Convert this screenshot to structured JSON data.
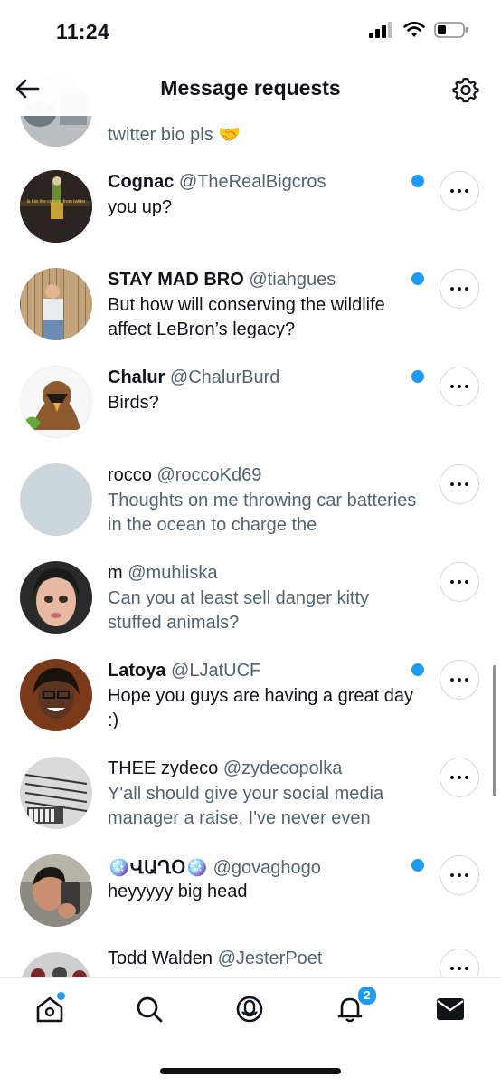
{
  "status": {
    "time": "11:24"
  },
  "header": {
    "title": "Message requests"
  },
  "partial_top": {
    "message": "twitter bio pls 🤝"
  },
  "requests": [
    {
      "name": "Cognac",
      "handle": "@TheRealBigcros",
      "message": "you up?",
      "unread": true
    },
    {
      "name": "STAY MAD BRO",
      "handle": "@tiahgues",
      "message": "But how will conserving the wildlife affect LeBron’s legacy?",
      "unread": true
    },
    {
      "name": "Chalur",
      "handle": "@ChalurBurd",
      "message": "Birds?",
      "unread": true
    },
    {
      "name": "rocco",
      "handle": "@roccoKd69",
      "message": "Thoughts on me throwing car batteries in the ocean to charge the",
      "unread": false
    },
    {
      "name": "m",
      "handle": "@muhliska",
      "message": "Can you at least sell danger kitty stuffed animals?",
      "unread": false
    },
    {
      "name": "Latoya",
      "handle": "@LJatUCF",
      "message": "Hope you guys are having a great day :)",
      "unread": true
    },
    {
      "name": "THEE zydeco",
      "handle": "@zydecopolka",
      "message": "Y'all should give your social media manager a raise, I've never even",
      "unread": false
    },
    {
      "name": "🪩ՎԱՂՕ🪩",
      "handle": "@govaghogo",
      "message": "heyyyyy big head",
      "unread": true
    },
    {
      "name": "Todd Walden",
      "handle": "@JesterPoet",
      "message": "",
      "unread": false
    }
  ],
  "avatar_captions": {
    "cognac": "Is this the cognac from twitter"
  },
  "tabbar": {
    "notifications_count": "2"
  },
  "colors": {
    "accent": "#1d9bf0",
    "secondary_text": "#536471",
    "primary_text": "#0f1419"
  }
}
